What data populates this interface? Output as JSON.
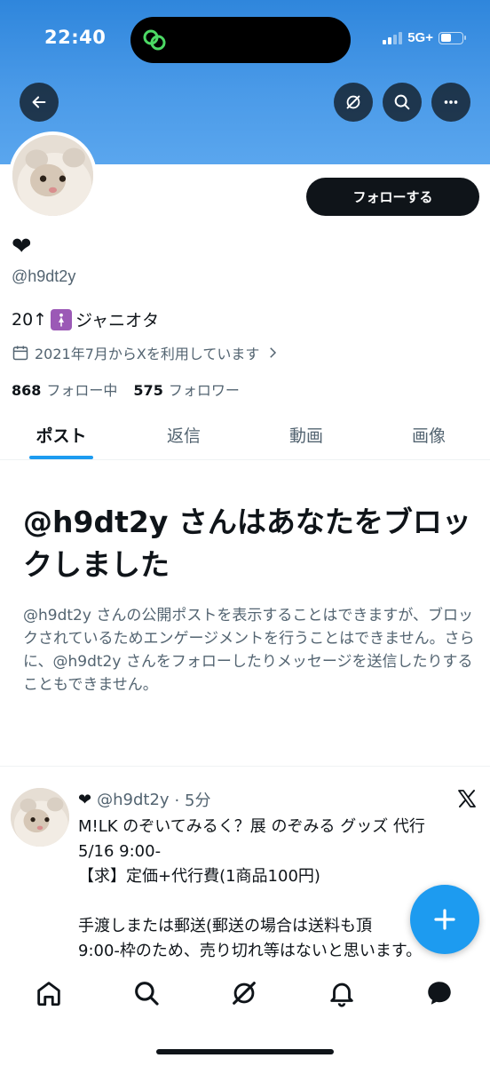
{
  "status_bar": {
    "time": "22:40",
    "network": "5G+"
  },
  "profile": {
    "display_name": "❤",
    "handle": "@h9dt2y",
    "bio_prefix": "20↑",
    "bio_suffix": "ジャニオタ",
    "joined": "2021年7月からXを利用しています",
    "following_count": "868",
    "following_label": "フォロー中",
    "followers_count": "575",
    "followers_label": "フォロワー",
    "follow_button": "フォローする"
  },
  "tabs": [
    "ポスト",
    "返信",
    "動画",
    "画像"
  ],
  "blocked": {
    "title": "@h9dt2y さんはあなたをブロックしました",
    "description": "@h9dt2y さんの公開ポストを表示することはできますが、ブロックされているためエンゲージメントを行うことはできません。さらに、@h9dt2y さんをフォローしたりメッセージを送信したりすることもできません。"
  },
  "post": {
    "name": "❤",
    "handle": "@h9dt2y",
    "time": "· 5分",
    "text": "M!LK のぞいてみるく？展 のぞみる グッズ 代行\n5/16 9:00-\n【求】定価+代行費(1商品100円)\n\n手渡しまたは郵送(郵送の場合は送料も頂\n9:00-枠のため、売り切れ等はないと思います。"
  },
  "colors": {
    "accent": "#1d9bf0",
    "banner": "#3f91e3",
    "text": "#0f1419",
    "muted": "#536471"
  }
}
